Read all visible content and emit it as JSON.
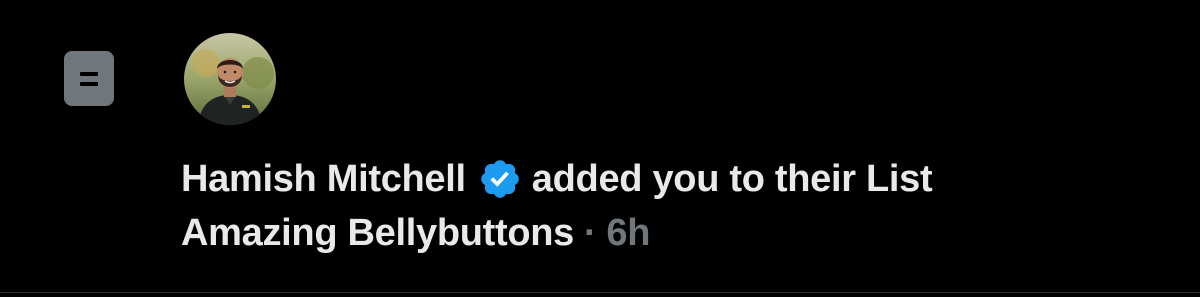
{
  "notification": {
    "type_icon": "list-icon",
    "avatar_icon": "user-avatar",
    "user_name": "Hamish Mitchell",
    "verified_icon": "verified-badge-icon",
    "action_text": "added you to their List",
    "list_name": "Amazing Bellybuttons",
    "separator": "·",
    "timestamp": "6h"
  },
  "colors": {
    "background": "#000000",
    "primary_text": "#e7e9ea",
    "secondary_text": "#71767b",
    "verified_blue": "#1d9bf0",
    "icon_gray": "#71767b"
  }
}
